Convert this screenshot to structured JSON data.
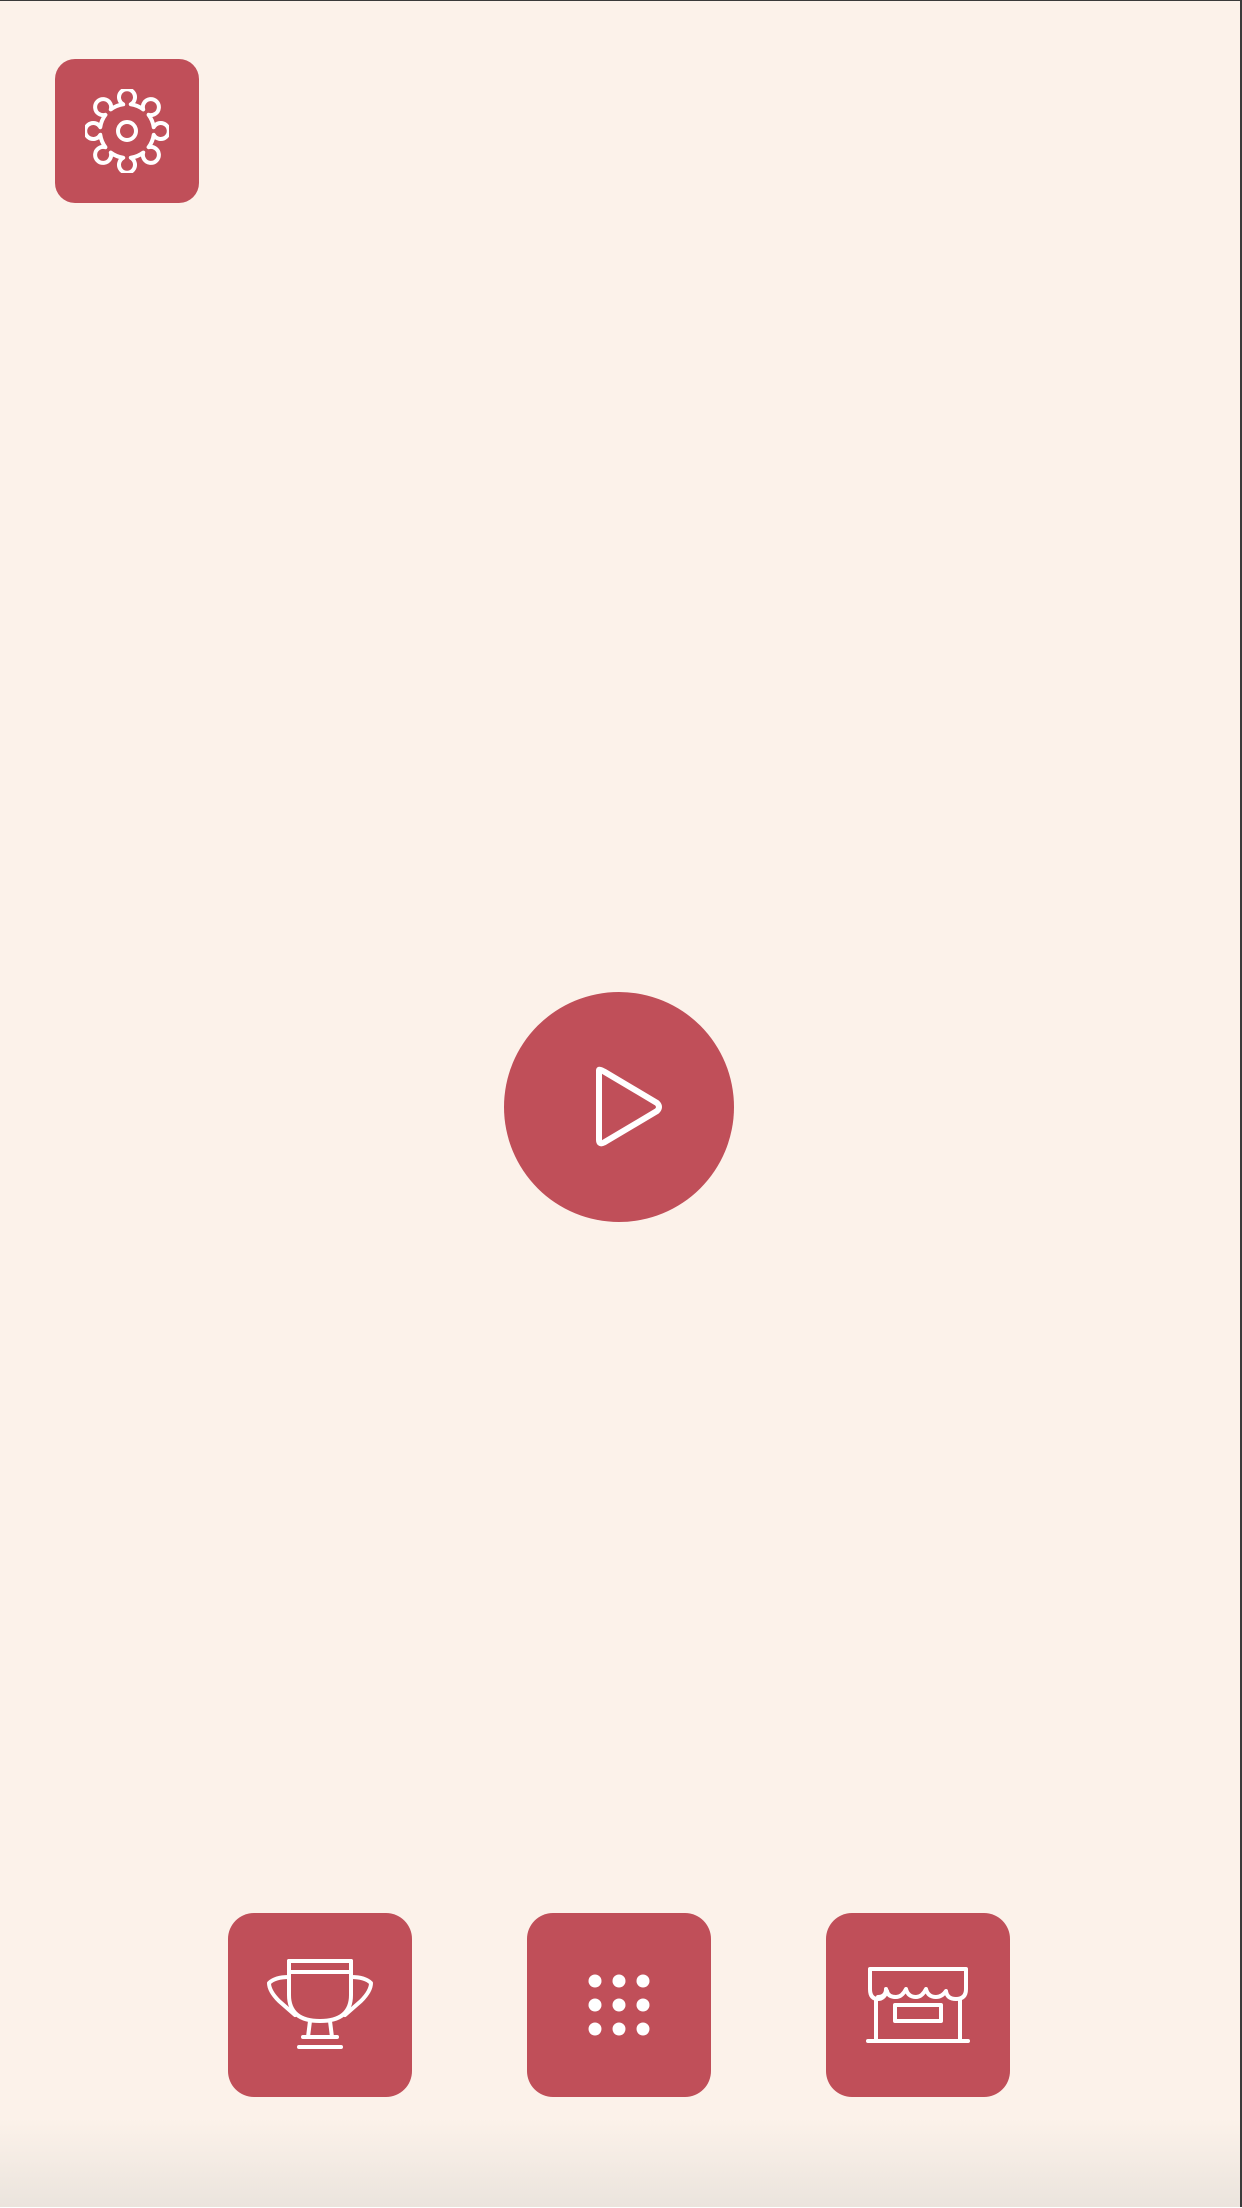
{
  "theme": {
    "background": "#fcf2ea",
    "button_color": "#c04f59",
    "icon_color": "#ffffff"
  },
  "settings_button": {
    "icon": "gear-icon"
  },
  "play_button": {
    "icon": "play-icon"
  },
  "bottom_bar": {
    "buttons": [
      {
        "id": "leaderboard",
        "icon": "trophy-icon"
      },
      {
        "id": "levels",
        "icon": "grid-dots-icon"
      },
      {
        "id": "shop",
        "icon": "storefront-icon"
      }
    ]
  }
}
